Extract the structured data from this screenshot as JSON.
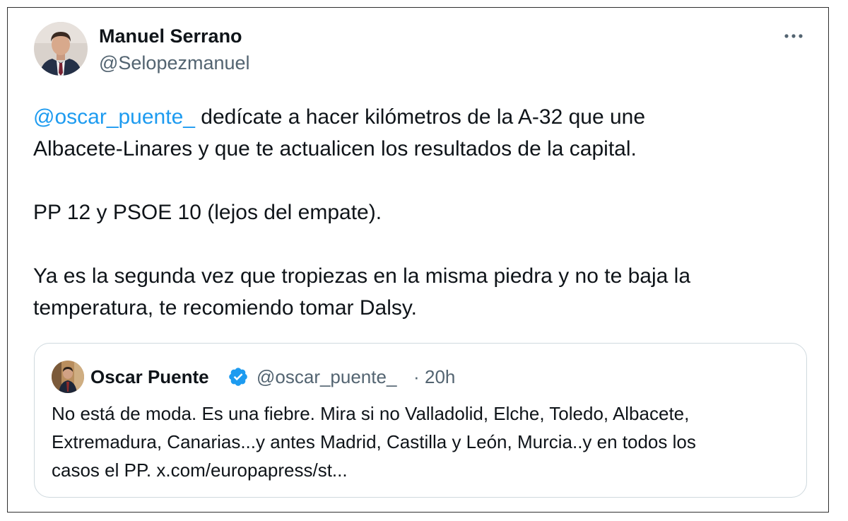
{
  "tweet": {
    "author": {
      "name": "Manuel Serrano",
      "handle": "@Selopezmanuel"
    },
    "more_label": "···",
    "body": {
      "mention": "@oscar_puente_",
      "line1_rest": " dedícate a hacer kilómetros de la A-32 que une",
      "line2": "Albacete-Linares y que te actualicen los resultados de la capital.",
      "paragraph2": "PP 12 y PSOE 10 (lejos del empate).",
      "paragraph3_line1": "Ya es la segunda vez que tropiezas en la misma piedra y no te baja la",
      "paragraph3_line2": "temperatura, te recomiendo tomar Dalsy."
    }
  },
  "quote": {
    "author": {
      "name": "Oscar Puente",
      "handle": "@oscar_puente_",
      "separator": "·",
      "time": "20h"
    },
    "text": {
      "line1": "No está de moda. Es una fiebre. Mira si no Valladolid, Elche, Toledo, Albacete,",
      "line2": "Extremadura, Canarias...y antes Madrid, Castilla y León, Murcia..y en todos los",
      "line3": "casos el PP. x.com/europapress/st..."
    }
  },
  "colors": {
    "accent": "#1d9bf0",
    "text": "#0f1419",
    "secondary": "#536471",
    "border": "#cfd9de"
  },
  "icons": {
    "more": "more-horizontal-icon",
    "verified": "verified-badge-icon"
  }
}
